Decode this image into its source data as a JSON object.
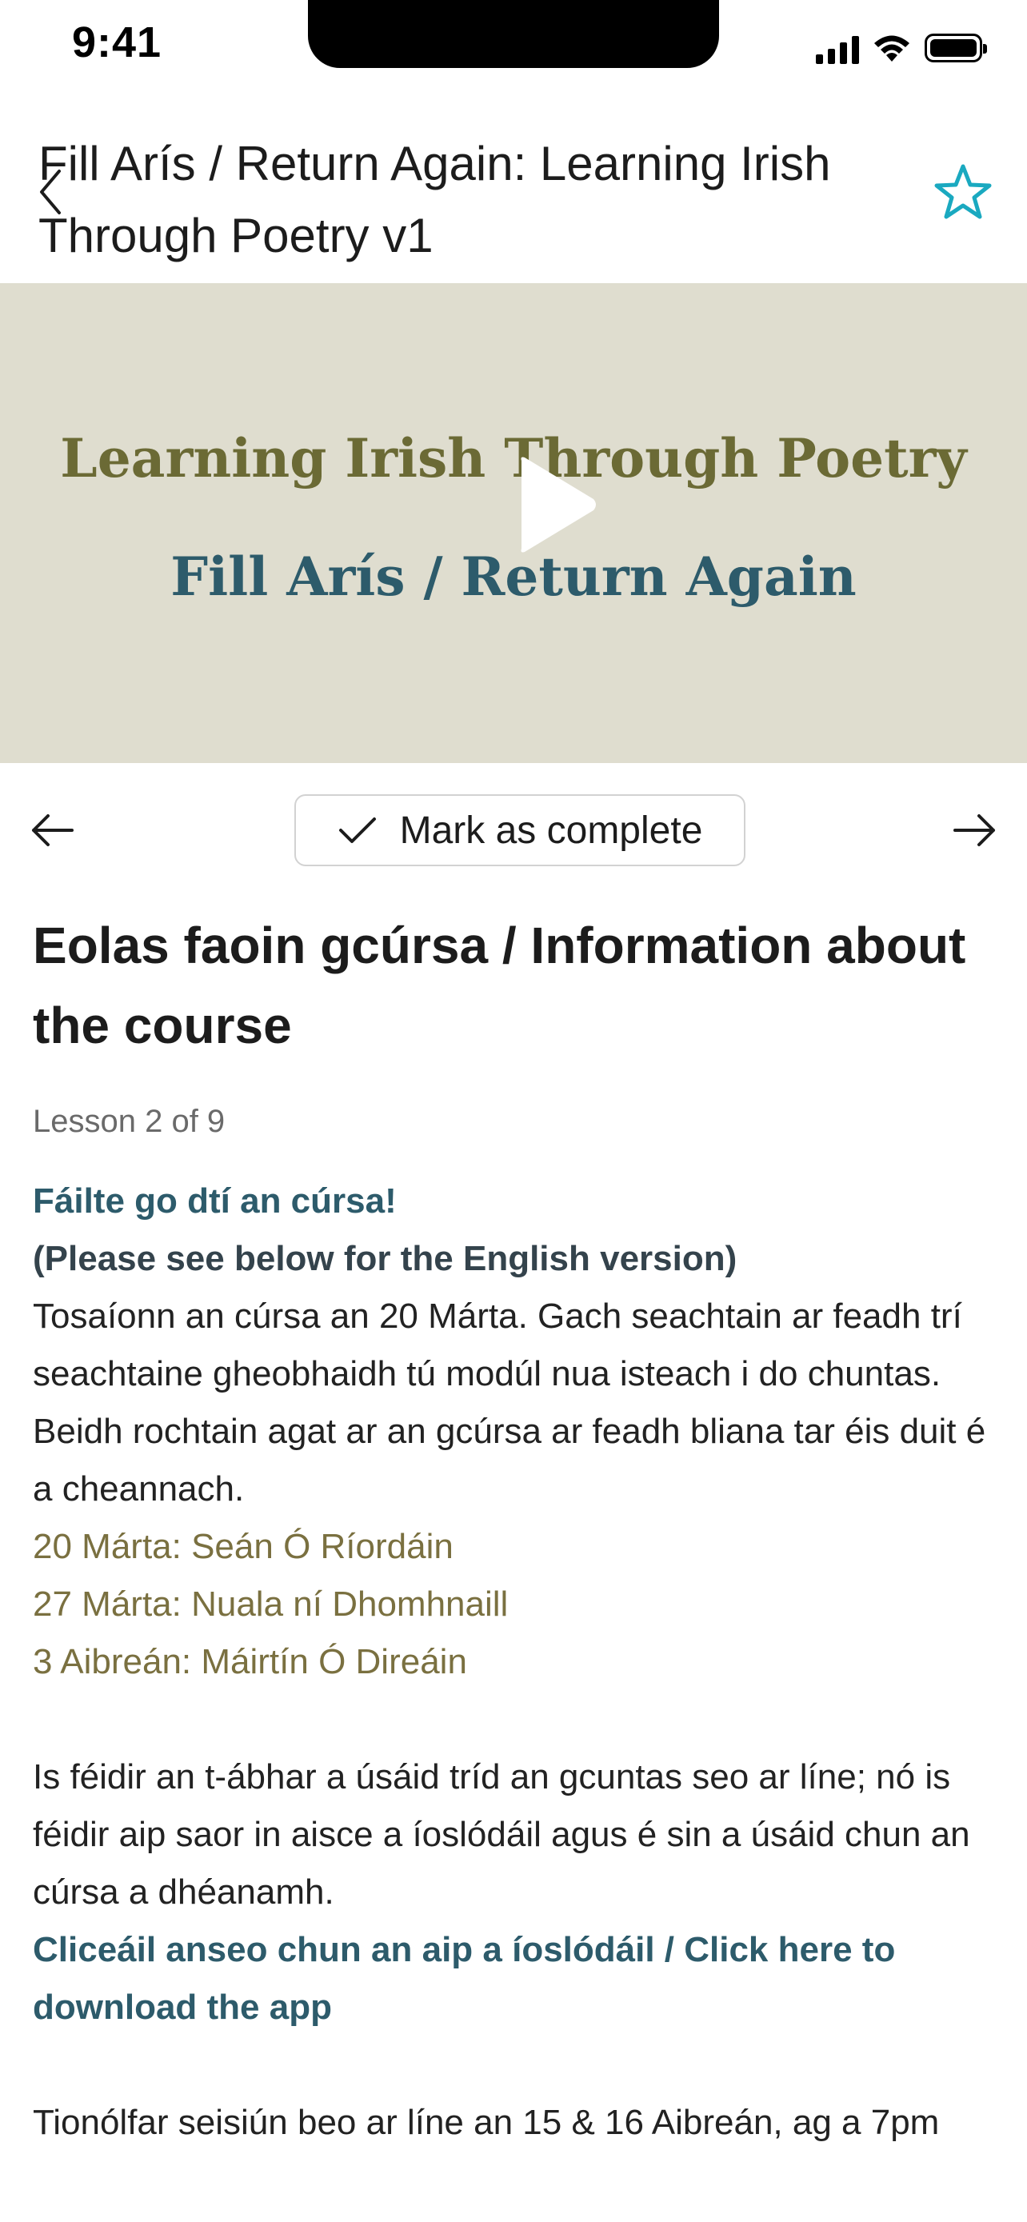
{
  "status_bar": {
    "time": "9:41"
  },
  "header": {
    "title": "Fill Arís / Return Again: Learning Irish Through Poetry v1"
  },
  "video": {
    "title_line1": "Learning Irish Through Poetry",
    "title_line2": "Fill Arís / Return Again"
  },
  "lesson_nav": {
    "complete_label": "Mark as complete"
  },
  "lesson": {
    "heading": "Eolas faoin gcúrsa / Information about the course",
    "counter": "Lesson 2 of 9",
    "welcome": "Fáilte go dtí an cúrsa!",
    "english_note": "(Please see below for the English version)",
    "para1": "Tosaíonn an cúrsa an 20 Márta. Gach seachtain ar feadh trí seachtaine gheobhaidh tú modúl nua isteach i do chuntas.",
    "para2": "Beidh rochtain agat ar an gcúrsa ar feadh bliana tar éis duit é a cheannach.",
    "schedule": [
      "20 Márta: Seán Ó Ríordáin",
      "27 Márta: Nuala ní Dhomhnaill",
      "3 Aibreán: Máirtín Ó Direáin"
    ],
    "para3": "Is féidir an t-ábhar a úsáid tríd an gcuntas seo ar líne; nó is féidir aip saor in aisce a íoslódáil agus é sin a úsáid chun an cúrsa a dhéanamh.",
    "app_link": "Cliceáil anseo chun an aip a íoslódáil / Click here to download the app",
    "para4": "Tionólfar seisiún beo ar líne an 15 & 16 Aibreán, ag a 7pm"
  },
  "colors": {
    "accent_teal": "#2d5b6b",
    "olive": "#7a7040",
    "star": "#1aa9c0",
    "video_bg": "#dfddcf"
  },
  "icons": {
    "back": "chevron-left-icon",
    "favorite": "star-outline-icon",
    "play": "play-icon",
    "prev": "arrow-left-icon",
    "next": "arrow-right-icon",
    "complete": "checkmark-icon"
  }
}
